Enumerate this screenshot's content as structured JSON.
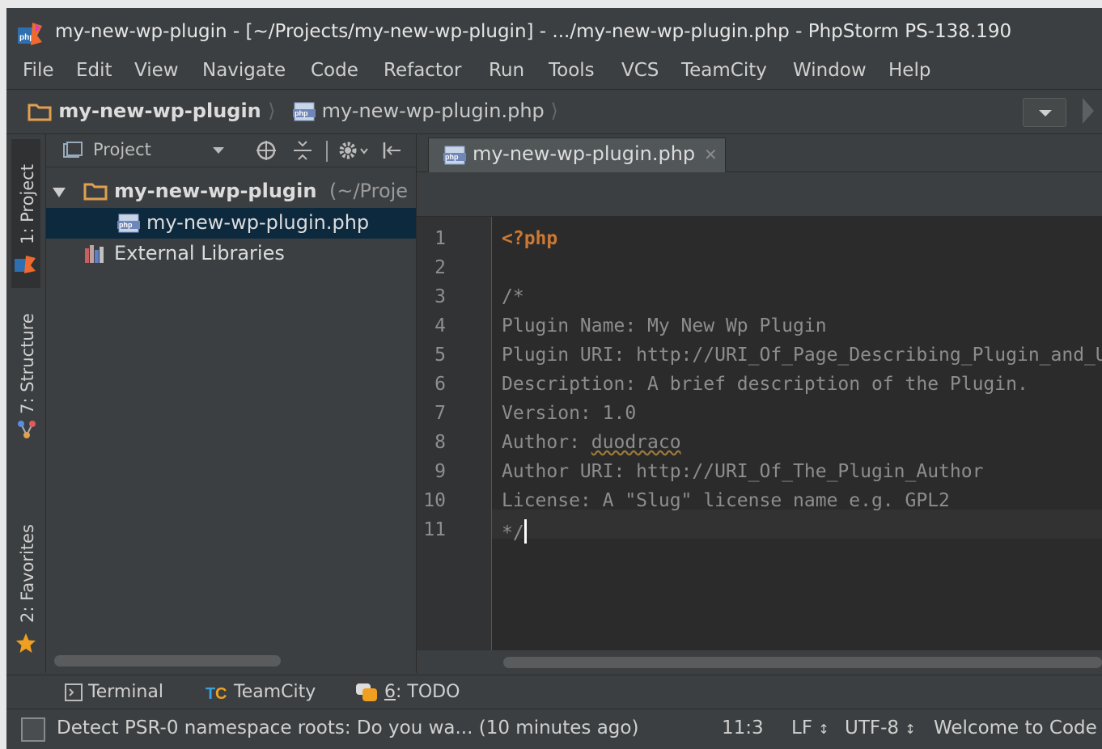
{
  "window": {
    "title": "my-new-wp-plugin - [~/Projects/my-new-wp-plugin] - .../my-new-wp-plugin.php - PhpStorm PS-138.190"
  },
  "menu": [
    "File",
    "Edit",
    "View",
    "Navigate",
    "Code",
    "Refactor",
    "Run",
    "Tools",
    "VCS",
    "TeamCity",
    "Window",
    "Help"
  ],
  "navbar": {
    "project": "my-new-wp-plugin",
    "file": "my-new-wp-plugin.php"
  },
  "left_stripe": {
    "project_tab": "1: Project",
    "structure_tab": "7: Structure",
    "favorites_tab": "2: Favorites"
  },
  "project_panel": {
    "view_label": "Project",
    "tree": {
      "root_name": "my-new-wp-plugin",
      "root_path": "(~/Proje",
      "file": "my-new-wp-plugin.php",
      "external": "External Libraries"
    }
  },
  "editor": {
    "tab_label": "my-new-wp-plugin.php",
    "line_numbers": [
      "1",
      "2",
      "3",
      "4",
      "5",
      "6",
      "7",
      "8",
      "9",
      "10",
      "11"
    ],
    "lines": {
      "l1": "<?php",
      "l2": "",
      "l3": "/*",
      "l4": "Plugin Name: My New Wp Plugin",
      "l5": "Plugin URI: http://URI_Of_Page_Describing_Plugin_and_Updates",
      "l6": "Description: A brief description of the Plugin.",
      "l7": "Version: 1.0",
      "l8_prefix": "Author: ",
      "l8_name": "duodraco",
      "l9": "Author URI: http://URI_Of_The_Plugin_Author",
      "l10": "License: A \"Slug\" license name e.g. GPL2",
      "l11": "*/"
    }
  },
  "bottom_tabs": {
    "terminal": "Terminal",
    "teamcity": "TeamCity",
    "todo_num": "6",
    "todo_label": ": TODO"
  },
  "status": {
    "message": "Detect PSR-0 namespace roots: Do you wa... (10 minutes ago)",
    "position": "11:3",
    "line_sep": "LF",
    "encoding": "UTF-8",
    "welcome": "Welcome to Code"
  },
  "colors": {
    "background": "#3c3f41",
    "editor_bg": "#2b2b2b",
    "keyword": "#cc7832",
    "selection": "#0d293e"
  }
}
